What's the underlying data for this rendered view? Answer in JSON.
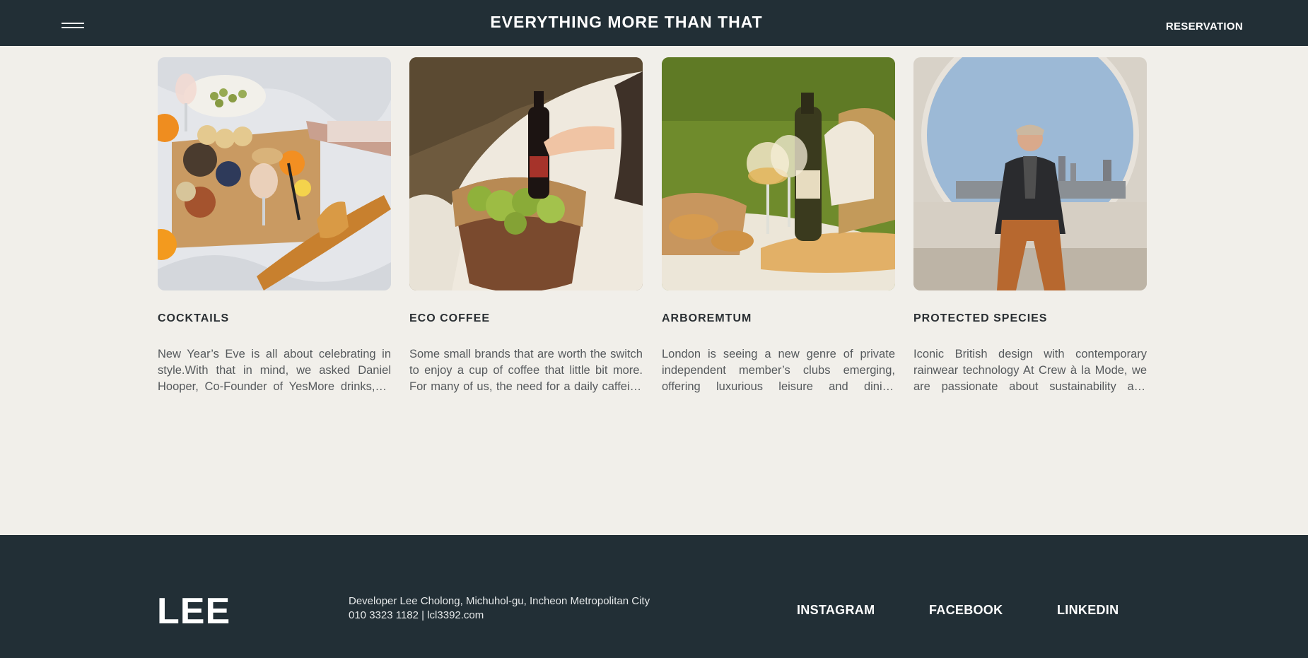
{
  "header": {
    "title": "EVERYTHING MORE THAN THAT",
    "reservation_label": "RESERVATION",
    "menu_icon": "hamburger-menu-icon"
  },
  "cards": [
    {
      "title": "COCKTAILS",
      "text": "New Year’s Eve is all about celebrating in style.With that in mind, we asked Daniel Hooper, Co-Founder of YesMore drinks, to share some of his favourite cocktail recipes."
    },
    {
      "title": "ECO COFFEE",
      "text": "Some small brands that are worth the switch to enjoy a cup of coffee that little bit more. For many of us, the need for a daily caffeine fix is a must."
    },
    {
      "title": "ARBOREMTUM",
      "text": "London is seeing a new genre of private independent member’s clubs emerging, offering luxurious leisure and dining experiences."
    },
    {
      "title": "PROTECTED SPECIES",
      "text": "Iconic British design with contemporary rainwear technology At Crew à la Mode, we are passionate about sustainability and quality."
    }
  ],
  "footer": {
    "logo": "LEE",
    "address": "Developer Lee Cholong, Michuhol-gu, Incheon Metropolitan City",
    "contact": "010 3323 1182 | lcl3392.com",
    "social": [
      "INSTAGRAM",
      "FACEBOOK",
      "LINKEDIN"
    ]
  },
  "colors": {
    "background": "#f1efea",
    "header_footer": "#222f36",
    "text_dark": "#2a2f33",
    "text_body": "#55595c"
  }
}
